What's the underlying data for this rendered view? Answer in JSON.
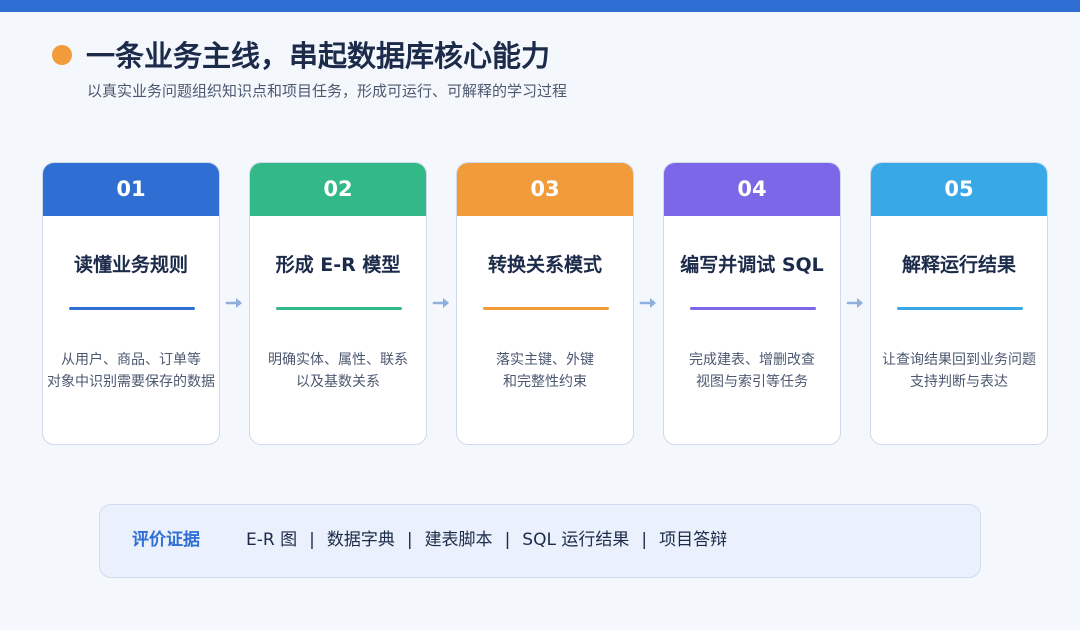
{
  "header": {
    "title": "一条业务主线，串起数据库核心能力",
    "subtitle": "以真实业务问题组织知识点和项目任务，形成可运行、可解释的学习过程"
  },
  "steps": [
    {
      "number": "01",
      "title": "读懂业务规则",
      "desc": [
        "从用户、商品、订单等",
        "对象中识别需要保存的数据"
      ],
      "color": "#2f6fd3"
    },
    {
      "number": "02",
      "title": "形成 E-R 模型",
      "desc": [
        "明确实体、属性、联系",
        "以及基数关系"
      ],
      "color": "#33b887"
    },
    {
      "number": "03",
      "title": "转换关系模式",
      "desc": [
        "落实主键、外键",
        "和完整性约束"
      ],
      "color": "#f29b3b"
    },
    {
      "number": "04",
      "title": "编写并调试 SQL",
      "desc": [
        "完成建表、增删改查",
        "视图与索引等任务"
      ],
      "color": "#7b67e8"
    },
    {
      "number": "05",
      "title": "解释运行结果",
      "desc": [
        "让查询结果回到业务问题",
        "支持判断与表达"
      ],
      "color": "#38a8e6"
    }
  ],
  "evidence": {
    "label": "评价证据",
    "items": [
      "E-R 图",
      "数据字典",
      "建表脚本",
      "SQL 运行结果",
      "项目答辩"
    ],
    "separator": "|"
  },
  "colors": {
    "accent": "#2f6fd3",
    "title_dot": "#f29b3b",
    "arrow": "#8fb0dd"
  },
  "icons": {
    "arrow": "arrow-right-icon"
  }
}
